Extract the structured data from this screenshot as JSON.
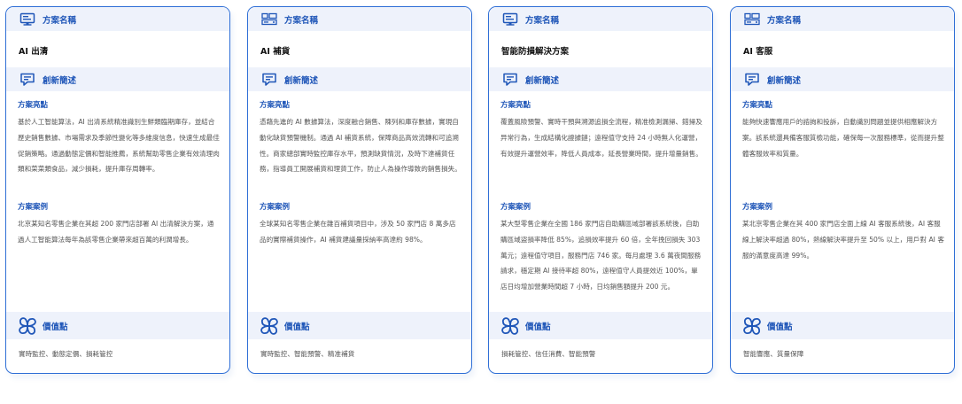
{
  "labels": {
    "solution_name": "方案名稱",
    "innovation": "創新簡述",
    "highlights": "方案亮點",
    "cases": "方案案例",
    "value": "價值點"
  },
  "icons": {
    "solution_name": [
      "monitor-icon",
      "server-monitor-icon",
      "monitor-icon",
      "server-monitor-icon"
    ],
    "innovation": "message-icon",
    "value": "clover-icon"
  },
  "colors": {
    "accent": "#1f56b8",
    "border": "#2f6fd6",
    "band": "#eef2fb"
  },
  "cards": [
    {
      "name": "AI 出清",
      "highlight": "基於人工智能算法，AI 出清系統精准識別生鮮類臨期庫存，並結合歷史銷售數據、市場需求及季節性變化等多維度信息，快速生成最佳促銷策略。通過動態定價和智能推薦，系統幫助零售企業有效清理肉類和菜菜類食品，減少損耗，提升庫存周轉率。",
      "case": "北京某知名零售企業在其超 200 家門店部署 AI 出清解決方案，通過人工智能算法每年為該零售企業帶來超百萬的利潤增長。",
      "value": "實時監控、動態定價、損耗管控"
    },
    {
      "name": "AI 補貨",
      "highlight": "憑藉先進的 AI 數據算法，深度融合銷售、陳列和庫存數據，實現自動化缺貨預警機制。通過 AI 補貨系統，保障商品高效流轉和可追溯性。商家總部實時監控庫存水平，預測缺貨情況，及時下達補貨任務，指導員工開展補貨和理貨工作，防止人為操作導致的銷售損失。",
      "case": "全球某知名零售企業在雜百補貨項目中，涉及 50 家門店 8 萬多店品的實際補貨操作，AI 補貨建議量採納率高達約 98%。",
      "value": "實時監控、智能預警、精准補貨"
    },
    {
      "name": "智能防損解決方案",
      "highlight": "覆蓋風險預警、實時干預與溯源追損全流程，精准檢測漏掃、錯掃及异常行為，生成結構化證據鏈；遠程值守支持 24 小時無人化運營，有效提升運營效率，降低人員成本，延長營業時間，提升增量銷售。",
      "case": "某大型零售企業在全國 186 家門店自助購區域部署該系統後，自助購區域盜損率降低 85%，追損效率提升 60 倍，全年挽回損失 303 萬元；遠程值守項目，服務門店 746 家。每月處理 3.6 萬夜間服務請求，穩定期 AI 接待率超 80%，遠程值守人員提效近 100%，單店日均增加營業時間超 7 小時，日均銷售額提升 200 元。",
      "value": "損耗管控、信任消費、智能預警"
    },
    {
      "name": "AI 客服",
      "highlight": "能夠快速響應用戶的諮詢和投訴，自動識別問題並提供相應解決方案。該系統還具備客服質檢功能，確保每一次服務標準，從而提升整體客服效率和質量。",
      "case": "某北京零售企業在其 400 家門店全面上線 AI 客服系統後，AI 客服線上解決率超過 80%，熱線解決率提升至 50% 以上，用戶對 AI 客服的滿意度高達 99%。",
      "value": "智能響應、質量保障"
    }
  ]
}
